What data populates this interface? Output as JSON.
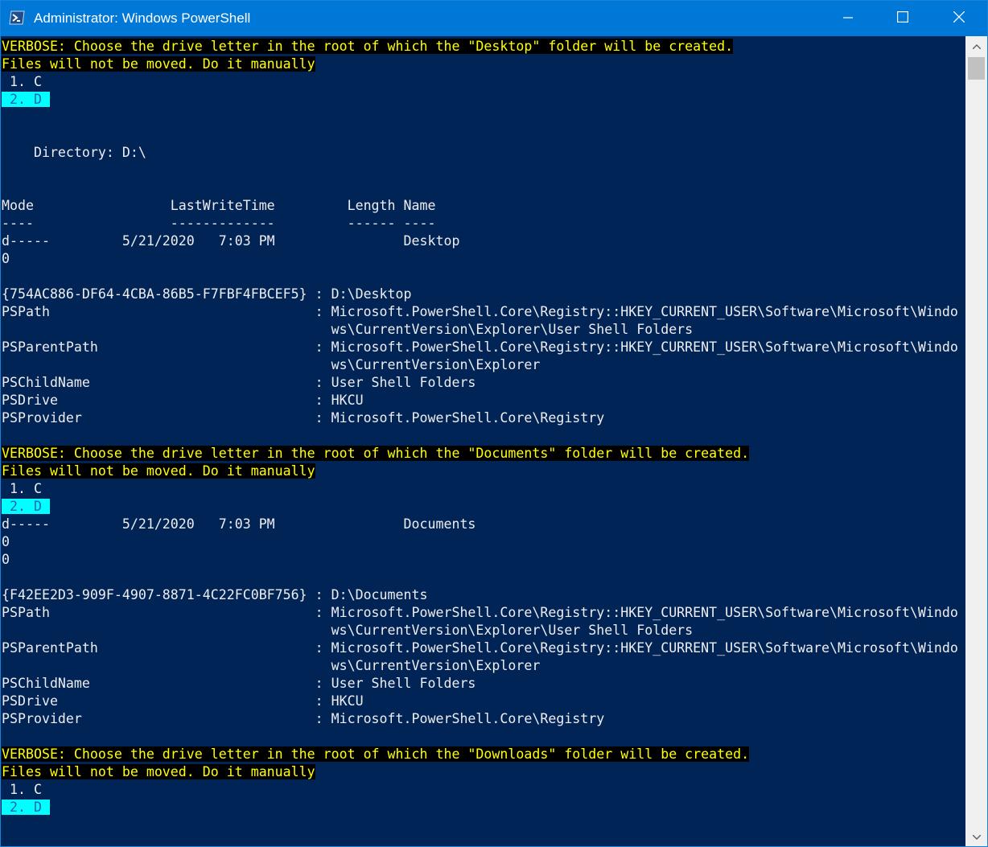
{
  "window": {
    "title": "Administrator: Windows PowerShell",
    "icon": "powershell-icon",
    "controls": [
      "minimize-icon",
      "maximize-icon",
      "close-icon"
    ]
  },
  "colors": {
    "titlebar": "#0078d7",
    "console_background": "#012456",
    "console_text": "#eeedf0",
    "verbose_text": "#ffff00",
    "verbose_background": "#000000",
    "selection_background": "#00ffff",
    "selection_text": "#1e63b9",
    "cursor": "#eeca95"
  },
  "console": {
    "lines": [
      {
        "text": "VERBOSE: Choose the drive letter in the root of which the \"Desktop\" folder will be created.",
        "style": "verbose"
      },
      {
        "text": "Files will not be moved. Do it manually",
        "style": "verbose"
      },
      {
        "text": " 1. C",
        "style": "normal"
      },
      {
        "text": " 2. D ",
        "style": "selected"
      },
      {
        "text": "",
        "style": "normal"
      },
      {
        "text": "",
        "style": "normal"
      },
      {
        "text": "    Directory: D:\\",
        "style": "normal"
      },
      {
        "text": "",
        "style": "normal"
      },
      {
        "text": "",
        "style": "normal"
      },
      {
        "text": "Mode                 LastWriteTime         Length Name",
        "style": "normal"
      },
      {
        "text": "----                 -------------         ------ ----",
        "style": "normal"
      },
      {
        "text": "d-----         5/21/2020   7:03 PM                Desktop",
        "style": "normal"
      },
      {
        "text": "0",
        "style": "normal"
      },
      {
        "text": "",
        "style": "normal"
      },
      {
        "text": "{754AC886-DF64-4CBA-86B5-F7FBF4FBCEF5} : D:\\Desktop",
        "style": "normal"
      },
      {
        "text": "PSPath                                 : Microsoft.PowerShell.Core\\Registry::HKEY_CURRENT_USER\\Software\\Microsoft\\Windo",
        "style": "normal"
      },
      {
        "text": "                                         ws\\CurrentVersion\\Explorer\\User Shell Folders",
        "style": "normal"
      },
      {
        "text": "PSParentPath                           : Microsoft.PowerShell.Core\\Registry::HKEY_CURRENT_USER\\Software\\Microsoft\\Windo",
        "style": "normal"
      },
      {
        "text": "                                         ws\\CurrentVersion\\Explorer",
        "style": "normal"
      },
      {
        "text": "PSChildName                            : User Shell Folders",
        "style": "normal"
      },
      {
        "text": "PSDrive                                : HKCU",
        "style": "normal"
      },
      {
        "text": "PSProvider                             : Microsoft.PowerShell.Core\\Registry",
        "style": "normal"
      },
      {
        "text": "",
        "style": "normal"
      },
      {
        "text": "VERBOSE: Choose the drive letter in the root of which the \"Documents\" folder will be created.",
        "style": "verbose"
      },
      {
        "text": "Files will not be moved. Do it manually",
        "style": "verbose"
      },
      {
        "text": " 1. C",
        "style": "normal"
      },
      {
        "text": " 2. D ",
        "style": "selected"
      },
      {
        "text": "d-----         5/21/2020   7:03 PM                Documents",
        "style": "normal"
      },
      {
        "text": "0",
        "style": "normal"
      },
      {
        "text": "0",
        "style": "normal"
      },
      {
        "text": "",
        "style": "normal"
      },
      {
        "text": "{F42EE2D3-909F-4907-8871-4C22FC0BF756} : D:\\Documents",
        "style": "normal"
      },
      {
        "text": "PSPath                                 : Microsoft.PowerShell.Core\\Registry::HKEY_CURRENT_USER\\Software\\Microsoft\\Windo",
        "style": "normal"
      },
      {
        "text": "                                         ws\\CurrentVersion\\Explorer\\User Shell Folders",
        "style": "normal"
      },
      {
        "text": "PSParentPath                           : Microsoft.PowerShell.Core\\Registry::HKEY_CURRENT_USER\\Software\\Microsoft\\Windo",
        "style": "normal"
      },
      {
        "text": "                                         ws\\CurrentVersion\\Explorer",
        "style": "normal"
      },
      {
        "text": "PSChildName                            : User Shell Folders",
        "style": "normal"
      },
      {
        "text": "PSDrive                                : HKCU",
        "style": "normal"
      },
      {
        "text": "PSProvider                             : Microsoft.PowerShell.Core\\Registry",
        "style": "normal"
      },
      {
        "text": "",
        "style": "normal"
      },
      {
        "text": "VERBOSE: Choose the drive letter in the root of which the \"Downloads\" folder will be created.",
        "style": "verbose"
      },
      {
        "text": "Files will not be moved. Do it manually",
        "style": "verbose"
      },
      {
        "text": " 1. C",
        "style": "normal"
      },
      {
        "text": " 2. D ",
        "style": "selected"
      },
      {
        "text": "",
        "style": "normal"
      },
      {
        "text": "",
        "style": "cursor"
      }
    ]
  }
}
